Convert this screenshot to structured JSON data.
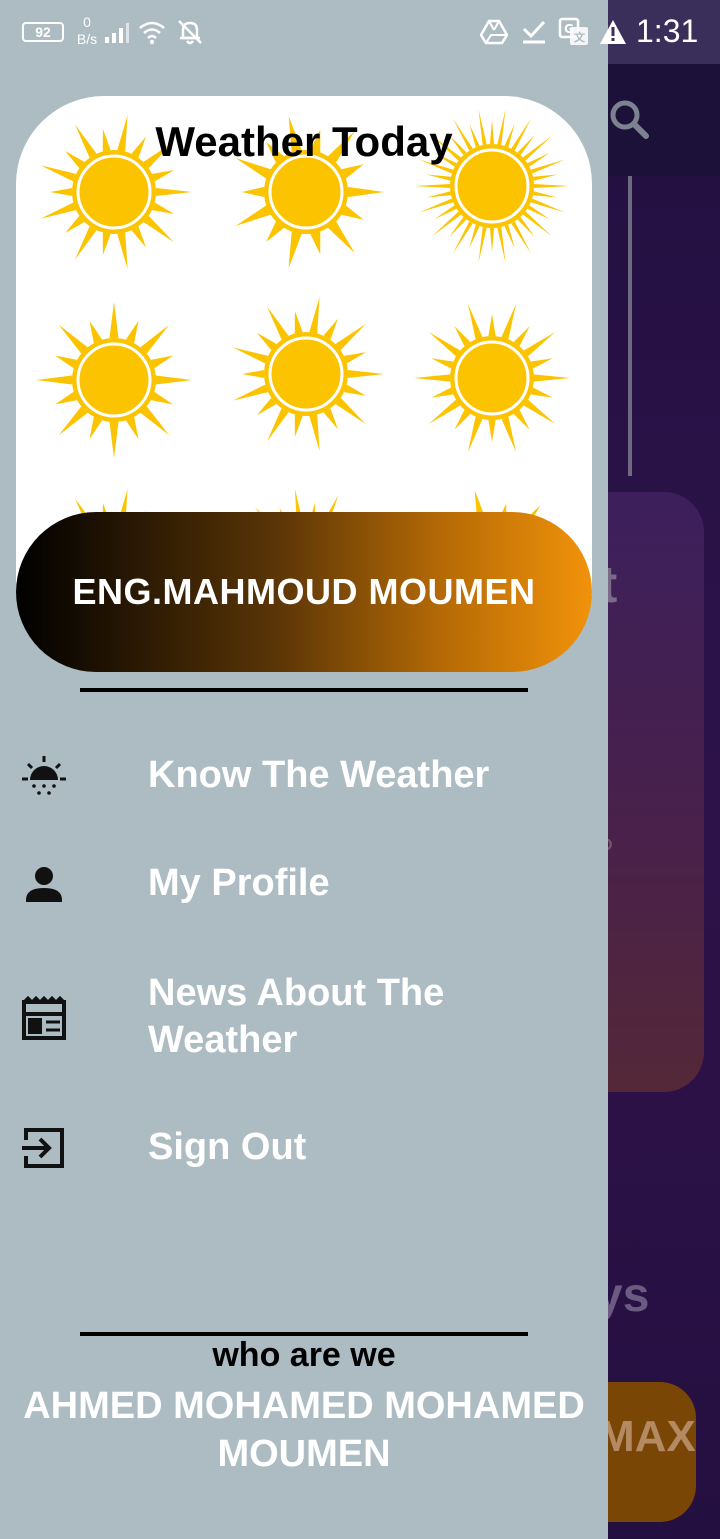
{
  "status_bar": {
    "battery": "92",
    "net_speed_value": "0",
    "net_speed_unit": "B/s",
    "time": "1:31"
  },
  "drawer": {
    "header_title": "Weather Today",
    "user_name": "ENG.MAHMOUD MOUMEN",
    "menu": [
      {
        "label": "Know The Weather",
        "icon": "weather-sunset-icon"
      },
      {
        "label": "My Profile",
        "icon": "person-icon"
      },
      {
        "label": "News About The Weather",
        "icon": "newspaper-icon"
      },
      {
        "label": "Sign Out",
        "icon": "exit-icon"
      }
    ],
    "footer": {
      "title": "who are we",
      "names": "AHMED MOHAMED MOHAMED MOUMEN"
    }
  },
  "background": {
    "card_partial_letter": "t",
    "days_partial": "ys",
    "max_partial": "MAX"
  },
  "colors": {
    "drawer_bg": "#adbcc3",
    "sun_yellow": "#fcc400",
    "banner_gradient_end": "#f1920a"
  }
}
